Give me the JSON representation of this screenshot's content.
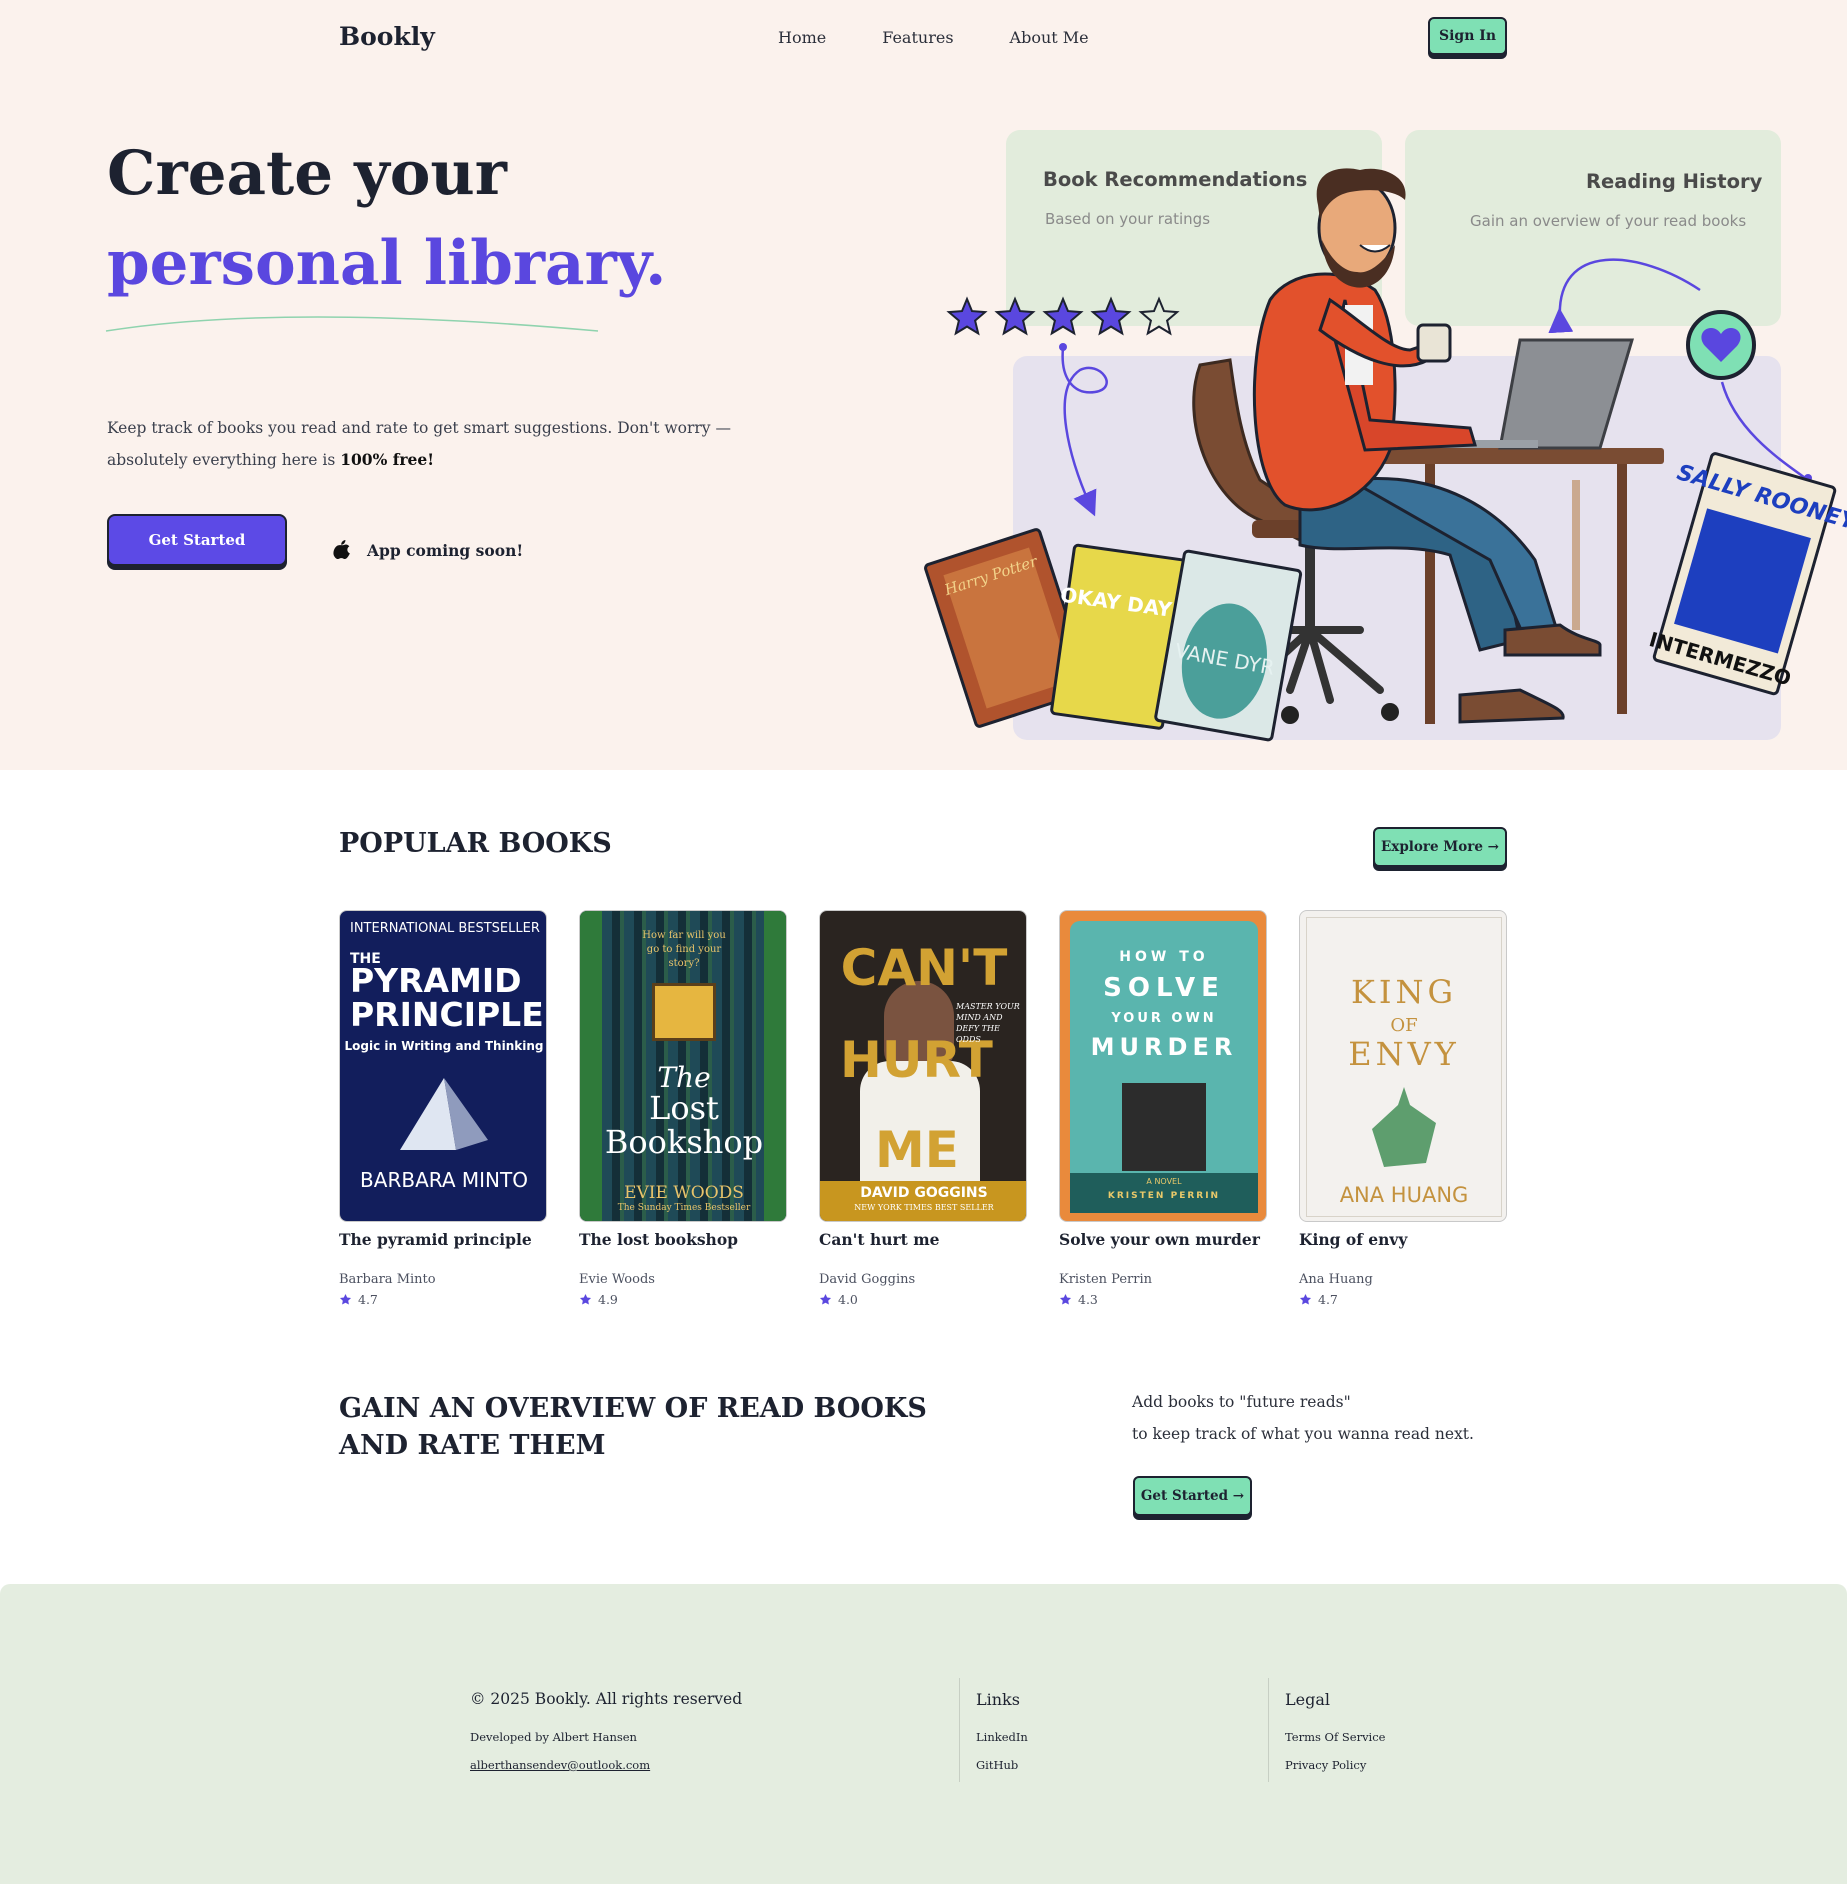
{
  "nav": {
    "logo": "Bookly",
    "links": [
      "Home",
      "Features",
      "About Me"
    ],
    "sign_in": "Sign In"
  },
  "hero": {
    "title_line1": "Create your",
    "title_line2": "personal library.",
    "description": "Keep track of books you read and rate to get smart suggestions. Don't worry — absolutely everything here is",
    "description_emphasis": "100% free!",
    "cta": "Get Started",
    "app_soon": "App coming soon!"
  },
  "feature_cards": [
    {
      "title": "Book Recommendations",
      "subtitle": "Based on your ratings"
    },
    {
      "title": "Reading History",
      "subtitle": "Gain an overview of your read books"
    }
  ],
  "illustration": {
    "rating_stars_filled": 4,
    "rating_stars_total": 5,
    "covers": [
      {
        "text": "Harry Potter",
        "color": "#b0532d"
      },
      {
        "text": "OKAY DAYS",
        "color": "#e7d84a"
      },
      {
        "text": "VANE DYR",
        "color": "#4b9f9a"
      },
      {
        "text": "SALLY ROONEY",
        "sub": "INTERMEZZO",
        "color": "#1d3fbf"
      }
    ]
  },
  "popular": {
    "heading": "POPULAR BOOKS",
    "explore": "Explore More →",
    "books": [
      {
        "title": "The pyramid principle",
        "author": "Barbara Minto",
        "rating": "4.7",
        "cover": {
          "top": "INTERNATIONAL BESTSELLER",
          "pre": "THE",
          "line1": "PYRAMID",
          "line2": "PRINCIPLE",
          "sub": "Logic in Writing and Thinking",
          "author": "BARBARA MINTO",
          "bg": "#121e5c"
        }
      },
      {
        "title": "The lost bookshop",
        "author": "Evie Woods",
        "rating": "4.9",
        "cover": {
          "top": "How far will you go to find your story?",
          "pre": "The",
          "line1": "Lost",
          "line2": "Bookshop",
          "author": "EVIE WOODS",
          "sub": "The Sunday Times Bestseller",
          "bg": "#173640"
        }
      },
      {
        "title": "Can't hurt me",
        "author": "David Goggins",
        "rating": "4.0",
        "cover": {
          "line1": "CAN'T",
          "line2": "HURT",
          "line3": "ME",
          "side": "MASTER YOUR MIND AND DEFY THE ODDS",
          "author": "DAVID GOGGINS",
          "sub": "NEW YORK TIMES BEST SELLER",
          "bg": "#2a2420"
        }
      },
      {
        "title": "Solve your own murder",
        "author": "Kristen Perrin",
        "rating": "4.3",
        "cover": {
          "pre": "HOW TO",
          "line1": "SOLVE",
          "mid": "YOUR OWN",
          "line2": "MURDER",
          "sub": "A NOVEL",
          "author": "KRISTEN PERRIN",
          "bg": "#5ab5ae"
        }
      },
      {
        "title": "King of envy",
        "author": "Ana Huang",
        "rating": "4.7",
        "cover": {
          "line1": "KING",
          "mid": "OF",
          "line2": "ENVY",
          "author": "ANA HUANG",
          "bg": "#f3f1ee"
        }
      }
    ]
  },
  "overview": {
    "title_line1": "GAIN AN OVERVIEW OF READ BOOKS",
    "title_line2": "AND RATE THEM",
    "line1": "Add books to \"future reads\"",
    "line2": "to keep track of what you wanna read next.",
    "cta": "Get Started →"
  },
  "footer": {
    "copyright": "© 2025 Bookly. All rights reserved",
    "developer": "Developed by Albert Hansen",
    "email": "alberthansendev@outlook.com",
    "links_heading": "Links",
    "links": [
      "LinkedIn",
      "GitHub"
    ],
    "legal_heading": "Legal",
    "legal": [
      "Terms Of Service",
      "Privacy Policy"
    ]
  },
  "colors": {
    "accent_purple": "#5a47df",
    "accent_green": "#7fe0b4",
    "hero_bg": "#fbf2ed",
    "footer_bg": "#e4ede0",
    "star": "#5a47df"
  }
}
